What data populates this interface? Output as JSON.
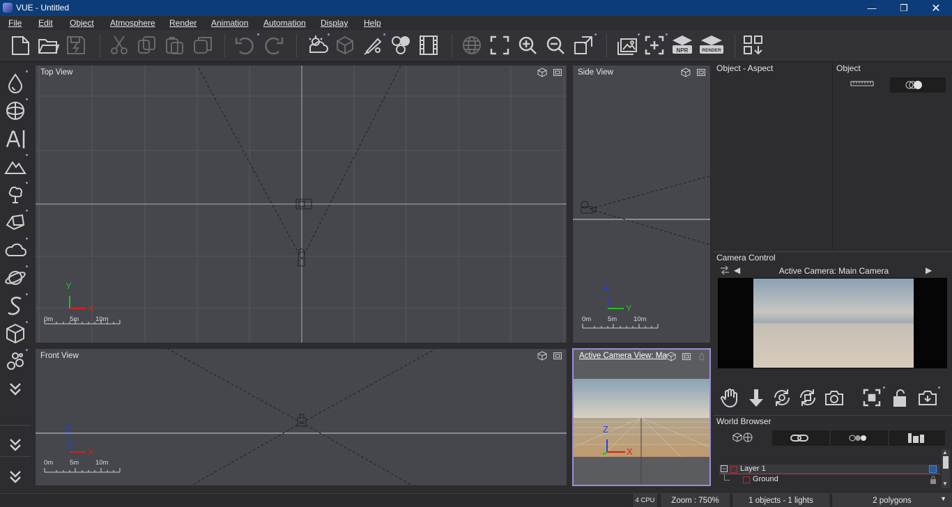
{
  "window": {
    "title": "VUE - Untitled"
  },
  "menu": [
    "File",
    "Edit",
    "Object",
    "Atmosphere",
    "Render",
    "Animation",
    "Automation",
    "Display",
    "Help"
  ],
  "toolbar": {
    "npr_label": "NPR",
    "render_label": "RENDER"
  },
  "viewports": {
    "top": {
      "title": "Top View",
      "axis_v": "Y",
      "axis_h": "X",
      "scale": [
        "0m",
        "5m",
        "10m"
      ]
    },
    "side": {
      "title": "Side View",
      "axis_v": "Z",
      "axis_h": "Y",
      "scale": [
        "0m",
        "5m",
        "10m"
      ]
    },
    "front": {
      "title": "Front View",
      "axis_v": "Z",
      "axis_h": "X",
      "scale": [
        "0m",
        "5m",
        "10m"
      ]
    },
    "camera": {
      "title": "Active Camera View: Mai",
      "axis_v": "Z",
      "axis_h": "X"
    }
  },
  "panels": {
    "object_aspect": {
      "title": "Object - Aspect"
    },
    "object": {
      "title": "Object"
    },
    "camera_control": {
      "title": "Camera Control",
      "active_camera": "Active Camera: Main Camera"
    },
    "world_browser": {
      "title": "World Browser",
      "items": [
        {
          "label": "Layer 1"
        },
        {
          "label": "Ground"
        }
      ]
    }
  },
  "status": {
    "cpu": "4 CPU",
    "zoom": "Zoom : 750%",
    "objects": "1 objects - 1 lights",
    "polygons": "2 polygons"
  },
  "colors": {
    "titlebar": "#0c3d78",
    "accent": "#9b8fd6",
    "viewport": "#45474c",
    "axis_x": "#d22020",
    "axis_y": "#20c020",
    "axis_z": "#2040e0"
  }
}
